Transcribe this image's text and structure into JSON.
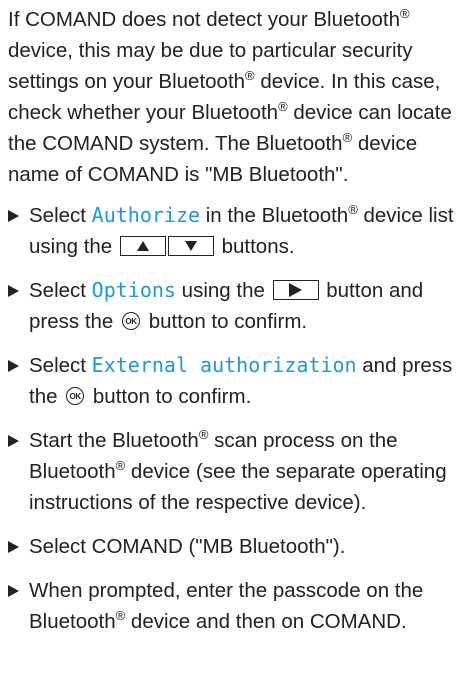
{
  "intro": {
    "p1": "If COMAND does not detect your Bluetooth",
    "p2": " device, this may be due to particular security settings on your Bluetooth",
    "p3": " device. In this case, check whether your Bluetooth",
    "p4": " device can locate the COMAND system. The Bluetooth",
    "p5": " device name of COMAND is \"MB Bluetooth\"."
  },
  "reg": "®",
  "ok_label": "OK",
  "steps": {
    "s1": {
      "pre": "Select ",
      "display": "Authorize",
      "mid": " in the Bluetooth",
      "post": " device list using the ",
      "end": " buttons."
    },
    "s2": {
      "pre": "Select ",
      "display": "Options",
      "mid": " using the ",
      "post": " button and press the ",
      "end": " button to confirm."
    },
    "s3": {
      "pre": "Select ",
      "display": "External authorization",
      "mid": " and press the ",
      "end": " button to confirm."
    },
    "s4": {
      "pre": "Start the Bluetooth",
      "mid": " scan process on the Bluetooth",
      "end": " device (see the separate operating instructions of the respective device)."
    },
    "s5": {
      "text": "Select COMAND (\"MB Bluetooth\")."
    },
    "s6": {
      "pre": "When prompted, enter the passcode on the Bluetooth",
      "end": " device and then on COMAND."
    }
  },
  "icons": {
    "up": "arrow-up-button-icon",
    "down": "arrow-down-button-icon",
    "right": "arrow-right-button-icon",
    "ok": "ok-button-icon"
  }
}
